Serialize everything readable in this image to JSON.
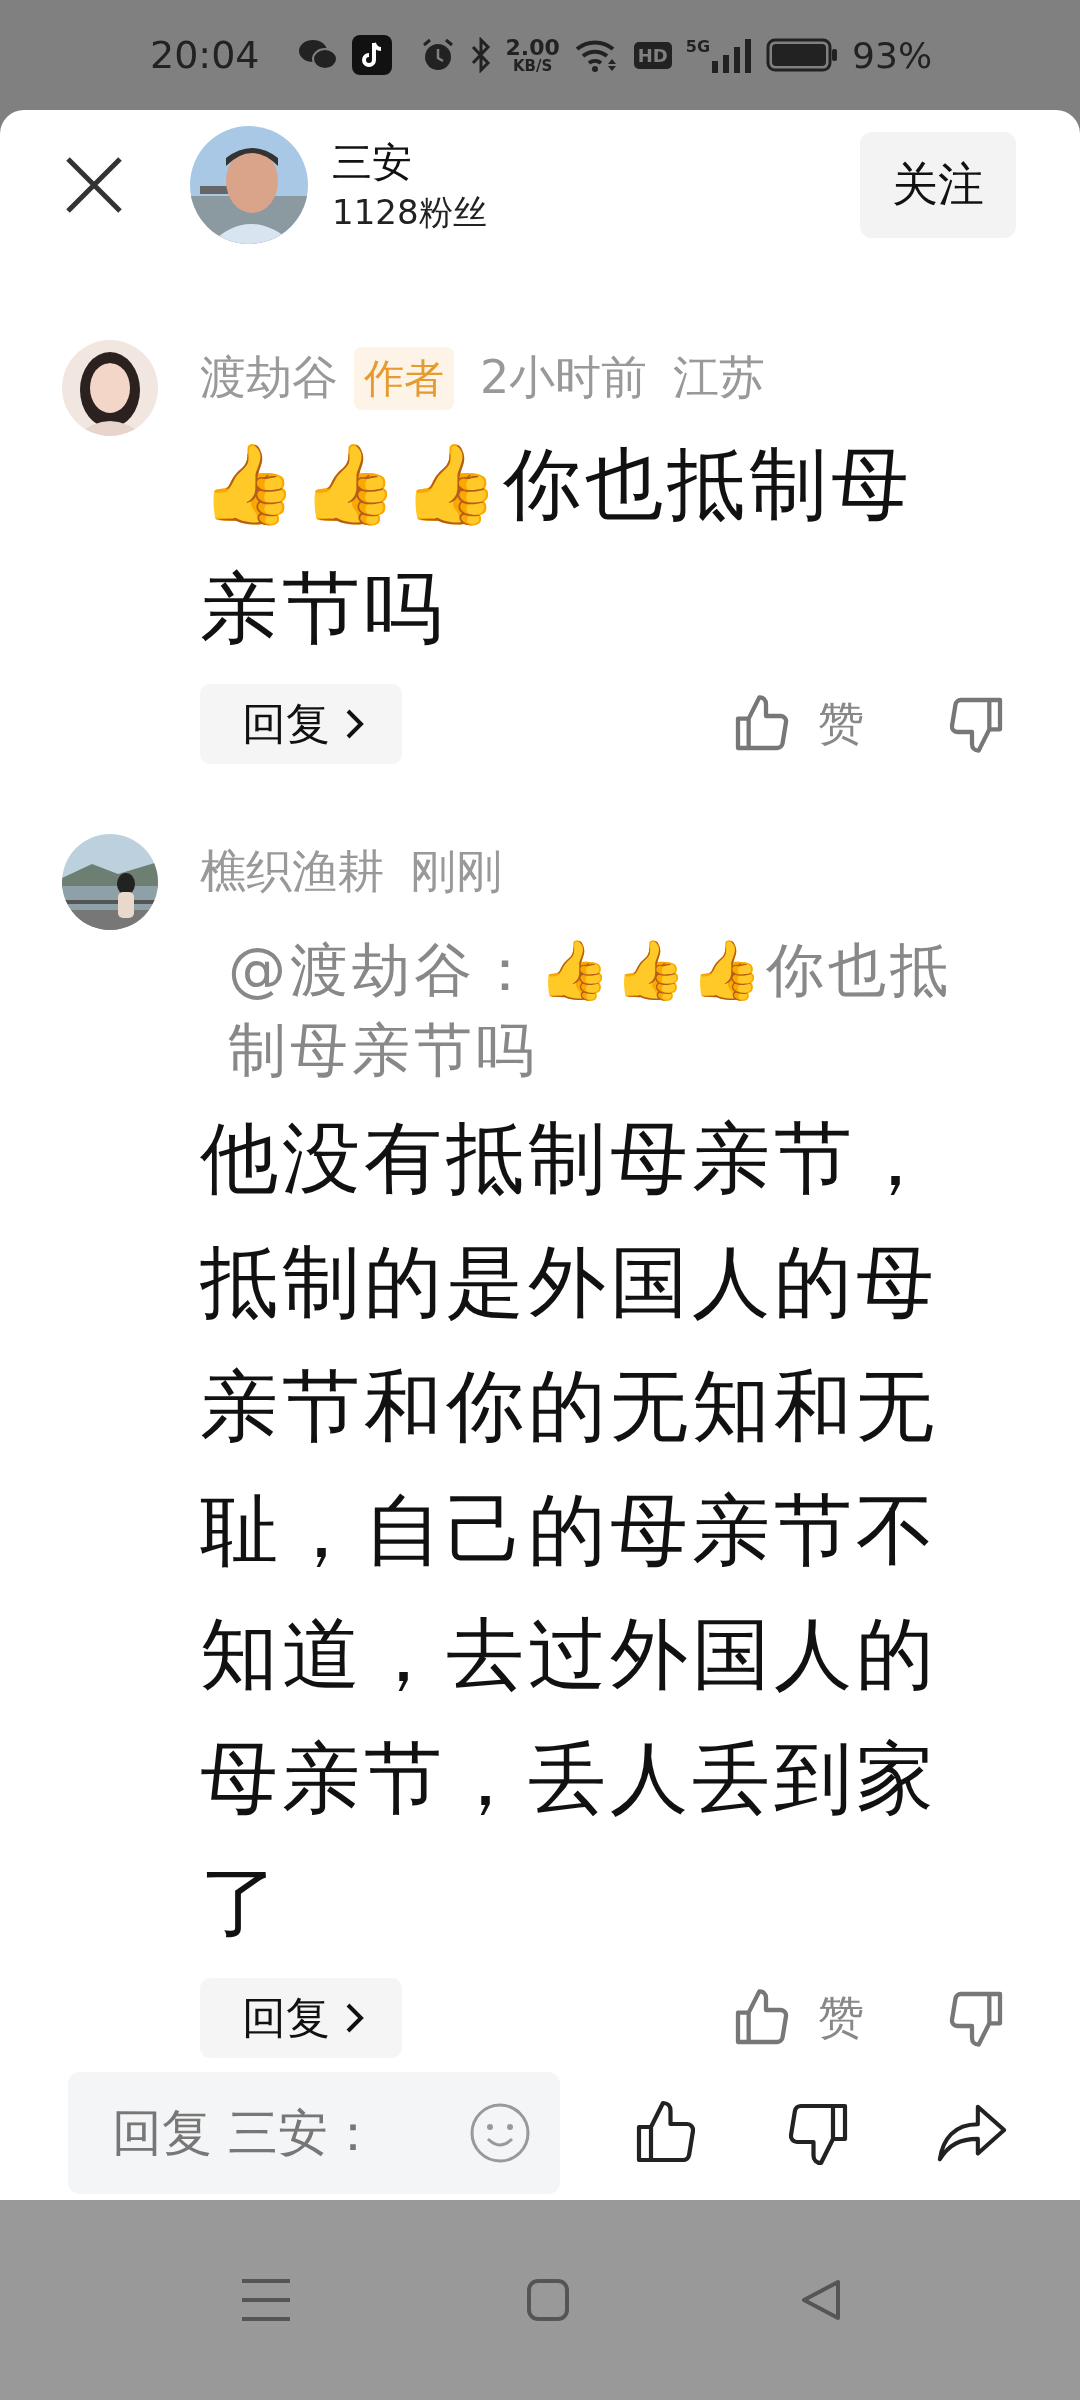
{
  "status_bar": {
    "time": "20:04",
    "speed_value": "2.00",
    "speed_unit": "KB/S",
    "hd_label": "HD",
    "network_label": "5G",
    "battery": "93%"
  },
  "header": {
    "name": "三安",
    "followers": "1128粉丝",
    "follow_button": "关注"
  },
  "comments": [
    {
      "author": "渡劫谷",
      "badge": "作者",
      "time": "2小时前",
      "location": "江苏",
      "content": "👍👍👍你也抵制母亲节吗",
      "reply_button": "回复",
      "like_label": "赞"
    },
    {
      "author": "樵织渔耕",
      "time": "刚刚",
      "quote": "@渡劫谷：👍👍👍你也抵制母亲节吗",
      "content": "他没有抵制母亲节，抵制的是外国人的母亲节和你的无知和无耻，自己的母亲节不知道，去过外国人的母亲节，丢人丢到家了",
      "reply_button": "回复",
      "like_label": "赞"
    }
  ],
  "reply_bar": {
    "placeholder": "回复 三安："
  }
}
